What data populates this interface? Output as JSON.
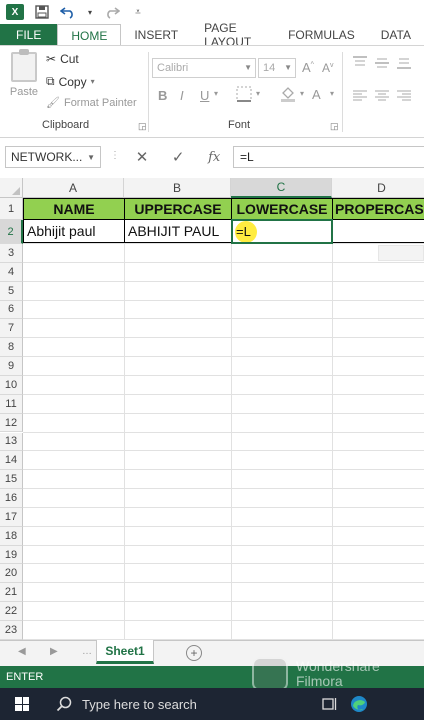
{
  "qat": {
    "app_icon": "X",
    "icons": [
      "save-icon",
      "undo-icon",
      "redo-icon",
      "customize-icon"
    ]
  },
  "tabs": [
    "FILE",
    "HOME",
    "INSERT",
    "PAGE LAYOUT",
    "FORMULAS",
    "DATA"
  ],
  "active_tab": "HOME",
  "ribbon": {
    "paste_label": "Paste",
    "cut_label": "Cut",
    "copy_label": "Copy",
    "format_painter_label": "Format Painter",
    "clipboard_group": "Clipboard",
    "font_name": "Calibri",
    "font_size": "14",
    "font_group": "Font",
    "bold": "B",
    "italic": "I",
    "underline": "U"
  },
  "formula_bar": {
    "name_box": "NETWORK...",
    "formula": "=L"
  },
  "columns": [
    "A",
    "B",
    "C",
    "D"
  ],
  "selected_column": "C",
  "rows": [
    "1",
    "2",
    "3",
    "4",
    "5",
    "6",
    "7",
    "8",
    "9",
    "10",
    "11",
    "12",
    "13",
    "14",
    "15",
    "16",
    "17",
    "18",
    "19",
    "20",
    "21",
    "22",
    "23"
  ],
  "selected_row": "2",
  "cells": {
    "a1": "NAME",
    "b1": "UPPERCASE",
    "c1": "LOWERCASE",
    "d1": "PROPERCASE",
    "a2": "Abhijit paul",
    "b2": "ABHIJIT PAUL",
    "c2": "=L"
  },
  "header_fill": "#92d050",
  "accent": "#217346",
  "sheet_tab": "Sheet1",
  "status": "ENTER",
  "watermark": {
    "line1": "Wondershare",
    "line2": "Filmora"
  },
  "taskbar": {
    "search_placeholder": "Type here to search"
  }
}
